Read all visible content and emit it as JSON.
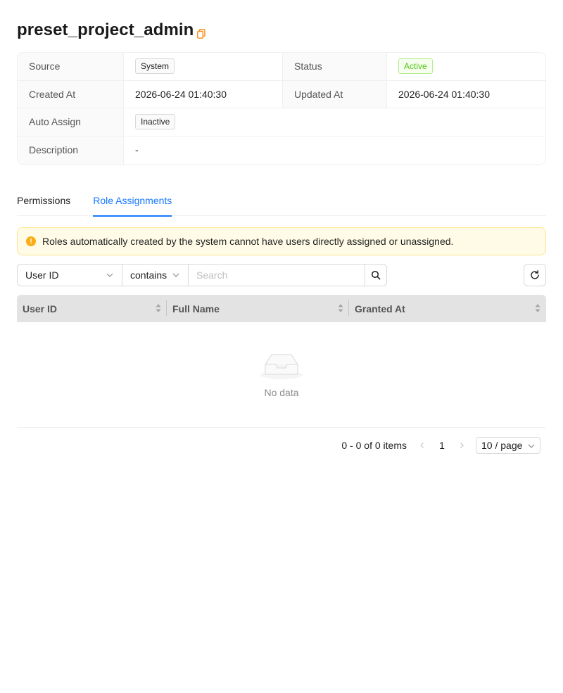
{
  "role": {
    "title": "preset_project_admin"
  },
  "details": {
    "source_label": "Source",
    "source_value": "System",
    "status_label": "Status",
    "status_value": "Active",
    "created_label": "Created At",
    "created_value": "2026-06-24 01:40:30",
    "updated_label": "Updated At",
    "updated_value": "2026-06-24 01:40:30",
    "auto_assign_label": "Auto Assign",
    "auto_assign_value": "Inactive",
    "description_label": "Description",
    "description_value": "-"
  },
  "tabs": [
    {
      "label": "Permissions",
      "active": false
    },
    {
      "label": "Role Assignments",
      "active": true
    }
  ],
  "alert": {
    "icon": "!",
    "message": "Roles automatically created by the system cannot have users directly assigned or unassigned."
  },
  "filter": {
    "field": "User ID",
    "operator": "contains",
    "search_placeholder": "Search"
  },
  "table": {
    "columns": [
      "User ID",
      "Full Name",
      "Granted At"
    ],
    "empty_text": "No data"
  },
  "pagination": {
    "total_text": "0 - 0 of 0 items",
    "current_page": "1",
    "page_size": "10 / page"
  },
  "colors": {
    "accent": "#1677ff",
    "warning": "#faad14",
    "success": "#52c41a",
    "copy_icon": "#fa8c16"
  }
}
